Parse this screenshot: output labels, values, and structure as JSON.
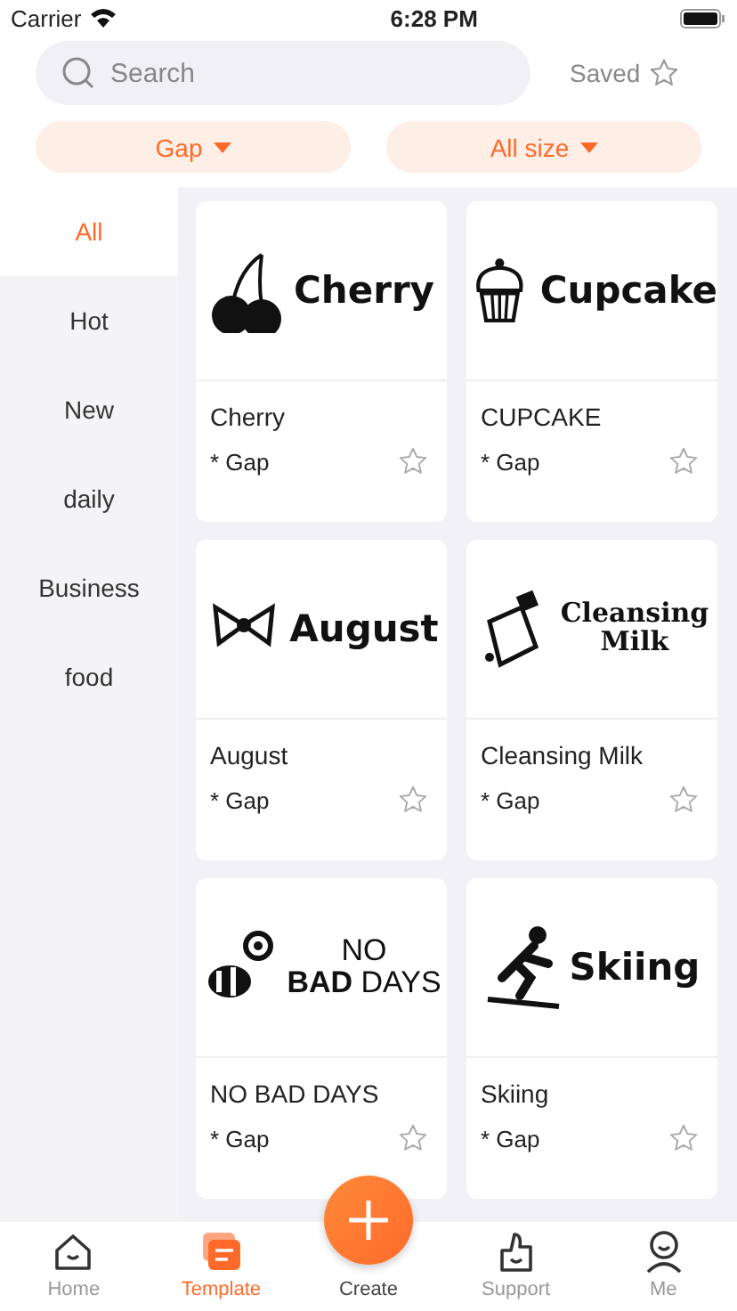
{
  "status_bar": {
    "carrier": "Carrier",
    "time": "6:28 PM"
  },
  "search": {
    "placeholder": "Search"
  },
  "saved_link": {
    "label": "Saved"
  },
  "filters": [
    {
      "label": "Gap"
    },
    {
      "label": "All size"
    }
  ],
  "categories": [
    {
      "label": "All",
      "selected": true
    },
    {
      "label": "Hot",
      "selected": false
    },
    {
      "label": "New",
      "selected": false
    },
    {
      "label": "daily",
      "selected": false
    },
    {
      "label": "Business",
      "selected": false
    },
    {
      "label": "food",
      "selected": false
    }
  ],
  "templates": [
    {
      "title": "Cherry",
      "tag": "* Gap",
      "saved": false,
      "art": {
        "kind": "cherry",
        "lines": [
          "Cherry"
        ]
      }
    },
    {
      "title": "CUPCAKE",
      "tag": "* Gap",
      "saved": false,
      "art": {
        "kind": "cupcake",
        "lines": [
          "Cupcake"
        ]
      }
    },
    {
      "title": "August",
      "tag": "* Gap",
      "saved": false,
      "art": {
        "kind": "bow",
        "lines": [
          "August"
        ]
      }
    },
    {
      "title": "Cleansing Milk",
      "tag": "* Gap",
      "saved": false,
      "art": {
        "kind": "tube",
        "lines": [
          "Cleansing",
          "Milk"
        ]
      }
    },
    {
      "title": "NO BAD DAYS",
      "tag": "* Gap",
      "saved": false,
      "art": {
        "kind": "bee",
        "lines": [
          "NO",
          "**BAD** DAYS"
        ]
      }
    },
    {
      "title": "Skiing",
      "tag": "* Gap",
      "saved": false,
      "art": {
        "kind": "skier",
        "lines": [
          "Skiing"
        ]
      }
    }
  ],
  "tab_bar": [
    {
      "label": "Home",
      "kind": "home",
      "selected": false
    },
    {
      "label": "Template",
      "kind": "template",
      "selected": true
    },
    {
      "label": "Create",
      "kind": "create",
      "selected": false
    },
    {
      "label": "Support",
      "kind": "support",
      "selected": false
    },
    {
      "label": "Me",
      "kind": "me",
      "selected": false
    }
  ]
}
